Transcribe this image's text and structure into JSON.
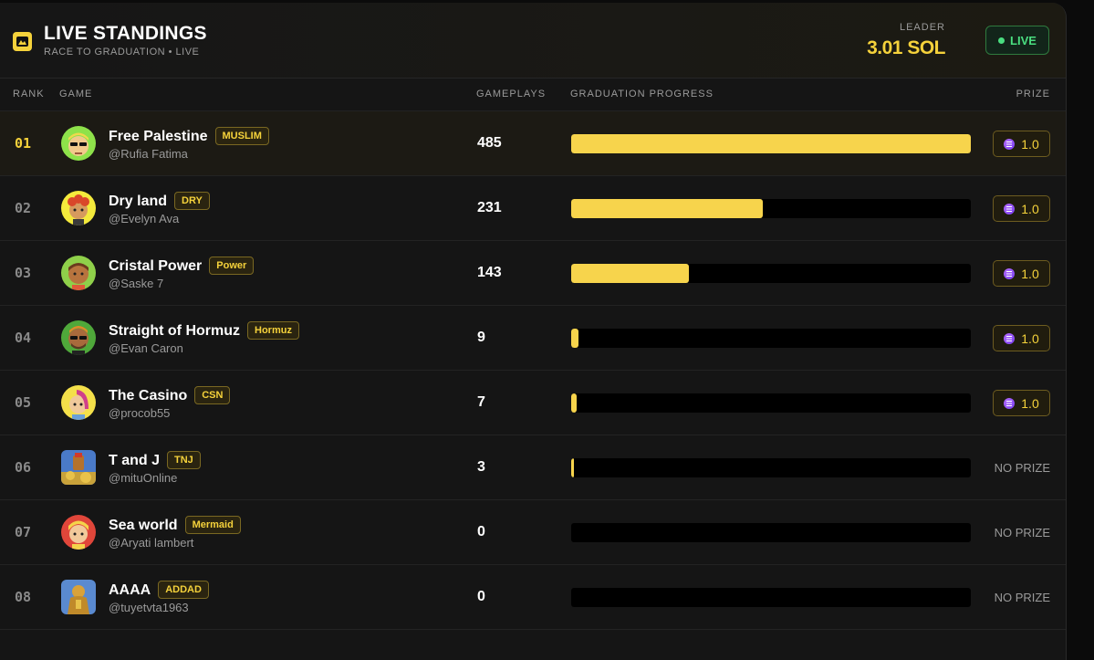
{
  "header": {
    "title": "LIVE STANDINGS",
    "subtitle": "RACE TO GRADUATION • LIVE",
    "leader_label": "LEADER",
    "leader_value": "3.01 SOL",
    "live_label": "LIVE"
  },
  "columns": {
    "rank": "RANK",
    "game": "GAME",
    "gameplays": "GAMEPLAYS",
    "progress": "GRADUATION PROGRESS",
    "prize": "PRIZE"
  },
  "rows": [
    {
      "rank": "01",
      "name": "Free Palestine",
      "tag": "MUSLIM",
      "handle": "@Rufia Fatima",
      "plays": "485",
      "progress": 1.0,
      "prize": "1.0",
      "avatar_icon": "sunglasses-avatar-icon"
    },
    {
      "rank": "02",
      "name": "Dry land",
      "tag": "DRY",
      "handle": "@Evelyn Ava",
      "plays": "231",
      "progress": 0.48,
      "prize": "1.0",
      "avatar_icon": "curly-hair-avatar-icon"
    },
    {
      "rank": "03",
      "name": "Cristal Power",
      "tag": "Power",
      "handle": "@Saske 7",
      "plays": "143",
      "progress": 0.295,
      "prize": "1.0",
      "avatar_icon": "brown-avatar-icon"
    },
    {
      "rank": "04",
      "name": "Straight of Hormuz",
      "tag": "Hormuz",
      "handle": "@Evan Caron",
      "plays": "9",
      "progress": 0.018,
      "prize": "1.0",
      "avatar_icon": "sunglasses-beard-avatar-icon"
    },
    {
      "rank": "05",
      "name": "The Casino",
      "tag": "CSN",
      "handle": "@procob55",
      "plays": "7",
      "progress": 0.014,
      "prize": "1.0",
      "avatar_icon": "pink-hair-avatar-icon"
    },
    {
      "rank": "06",
      "name": "T and J",
      "tag": "TNJ",
      "handle": "@mituOnline",
      "plays": "3",
      "progress": 0.005,
      "prize": "NO PRIZE",
      "avatar_icon": "gold-treasure-image-icon"
    },
    {
      "rank": "07",
      "name": "Sea world",
      "tag": "Mermaid",
      "handle": "@Aryati lambert",
      "plays": "0",
      "progress": 0,
      "prize": "NO PRIZE",
      "avatar_icon": "blonde-avatar-icon"
    },
    {
      "rank": "08",
      "name": "AAAA",
      "tag": "ADDAD",
      "handle": "@tuyetvta1963",
      "plays": "0",
      "progress": 0,
      "prize": "NO PRIZE",
      "avatar_icon": "gold-warrior-image-icon"
    }
  ],
  "colors": {
    "accent": "#f5d23b",
    "live_green": "#4ade80",
    "progress_fill": "#f7d44c",
    "background": "#151515"
  }
}
